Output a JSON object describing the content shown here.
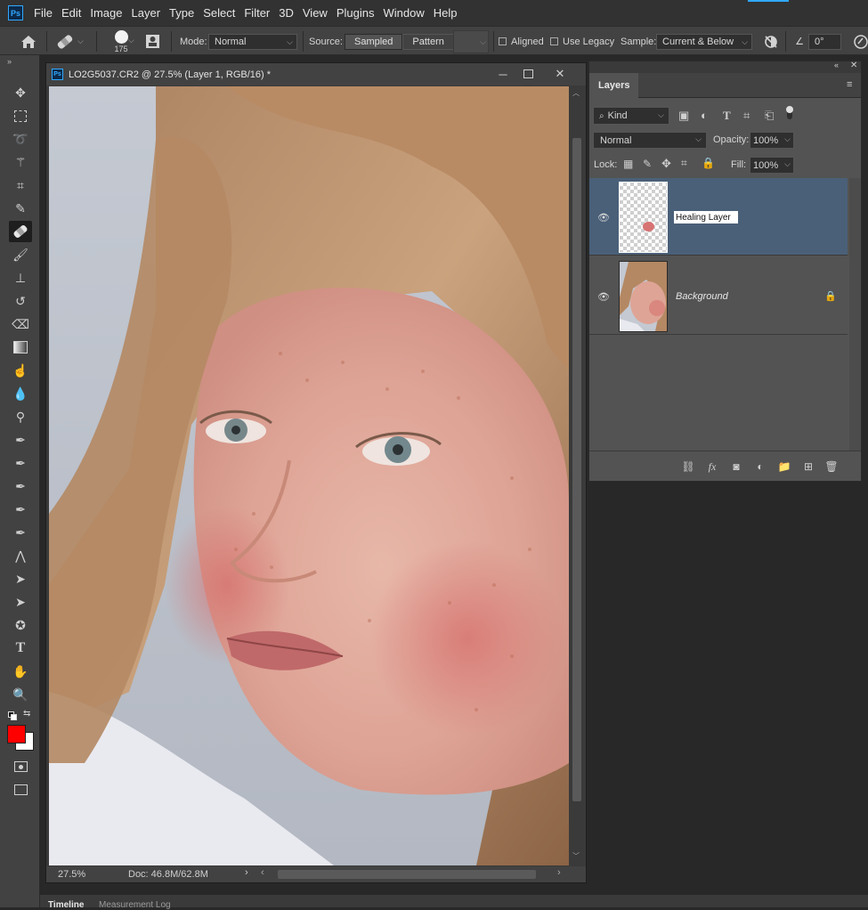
{
  "app": {
    "logo": "Ps"
  },
  "menu": [
    "File",
    "Edit",
    "Image",
    "Layer",
    "Type",
    "Select",
    "Filter",
    "3D",
    "View",
    "Plugins",
    "Window",
    "Help"
  ],
  "options": {
    "brush_size": "175",
    "mode_label": "Mode:",
    "mode_value": "Normal",
    "source_label": "Source:",
    "source_sampled": "Sampled",
    "source_pattern": "Pattern",
    "aligned_label": "Aligned",
    "use_legacy_label": "Use Legacy",
    "sample_label": "Sample:",
    "sample_value": "Current & Below",
    "angle_value": "0°"
  },
  "tools": [
    "move-tool",
    "marquee-tool",
    "lasso-tool",
    "magic-wand-tool",
    "crop-tool",
    "eyedropper-tool",
    "healing-brush-tool",
    "brush-tool",
    "clone-stamp-tool",
    "history-brush-tool",
    "eraser-tool",
    "gradient-tool",
    "smudge-tool",
    "blur-tool",
    "dodge-tool",
    "pen-tool",
    "freeform-pen-tool",
    "curvature-pen-tool",
    "add-anchor-tool",
    "delete-anchor-tool",
    "convert-point-tool",
    "path-selection-tool",
    "direct-selection-tool",
    "custom-shape-tool",
    "type-tool",
    "hand-tool",
    "zoom-tool"
  ],
  "colors": {
    "foreground": "#ff0000",
    "background": "#ffffff",
    "accent": "#31a8ff",
    "layer_selected": "#4a6078"
  },
  "document": {
    "title": "LO2G5037.CR2 @ 27.5% (Layer 1, RGB/16) *",
    "zoom": "27.5%",
    "doc_size": "Doc: 46.8M/62.8M"
  },
  "layers_panel": {
    "tab": "Layers",
    "filter_kind": "Kind",
    "blend_mode": "Normal",
    "opacity_label": "Opacity:",
    "opacity_value": "100%",
    "lock_label": "Lock:",
    "fill_label": "Fill:",
    "fill_value": "100%",
    "layers": [
      {
        "name": "Healing Layer",
        "selected": true,
        "visible": true
      },
      {
        "name": "Background",
        "selected": false,
        "visible": true,
        "locked": true
      }
    ]
  },
  "bottom_tabs": [
    "Timeline",
    "Measurement Log"
  ]
}
